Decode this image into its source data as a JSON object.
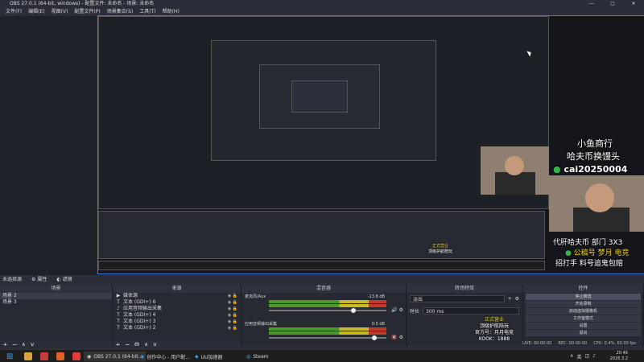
{
  "window": {
    "title": "OBS 27.0.1 (64-bit, windows) - 配置文件: 未命名 - 场景: 未命名",
    "controls": [
      "—",
      "▢",
      "✕"
    ]
  },
  "menu": [
    "文件(F)",
    "编辑(E)",
    "视图(V)",
    "配置文件(P)",
    "场景集合(S)",
    "工具(T)",
    "帮助(H)"
  ],
  "overlay": {
    "shop_line1": "小鱼商行",
    "shop_line2": "哈夫币换馒头",
    "wechat": "cai20250004",
    "stream_line1": "代肝哈夫币 部门 3X3",
    "stream_line2_a": "公稿号",
    "stream_line2_b": "梦月 电竞",
    "stream_line3": "招打手 料号追鬼包赔",
    "badge_line1": "正式营业",
    "badge_line2": "顶级护航陪玩",
    "badge_line3": "官方号：月月电竞",
    "badge_line4": "KOOK：1888"
  },
  "scene_bar": {
    "label": "未选择源",
    "properties": "属性",
    "filters": "滤镜"
  },
  "scenes": {
    "header": "场景",
    "items": [
      "场景 2",
      "场景 3"
    ],
    "selected": 0
  },
  "sources": {
    "header": "来源",
    "items": [
      {
        "label": "媒体源",
        "icon": "▶"
      },
      {
        "label": "文本 (GDI+) 6",
        "icon": "T"
      },
      {
        "label": "应用音频输出采集",
        "icon": "♪"
      },
      {
        "label": "文本 (GDI+) 4",
        "icon": "T"
      },
      {
        "label": "文本 (GDI+) 3",
        "icon": "T"
      },
      {
        "label": "文本 (GDI+) 2",
        "icon": "T"
      }
    ]
  },
  "mixer": {
    "header": "混音器",
    "channels": [
      {
        "name": "麦克风/Aux",
        "db": "-13.8 dB",
        "level": 0.72
      },
      {
        "name": "应用音频输出采集",
        "db": "0.0 dB",
        "level": 0.9
      }
    ]
  },
  "transitions": {
    "header": "转场特效",
    "effect": "淡出",
    "duration_label": "时长",
    "duration_value": "300 ms"
  },
  "controls": {
    "header": "控件",
    "buttons": [
      "停止推流",
      "开始录制",
      "启动虚拟摄像机",
      "工作室模式",
      "设置",
      "退出"
    ],
    "selected": 0
  },
  "status": {
    "live": "LIVE: 00:00:00",
    "rec": "REC: 00:00:00",
    "cpu": "CPU: 0.4%, 60.00 fps"
  },
  "taskbar": {
    "items": [
      "OBS 27.0.1 (64-bit...",
      "创作中心 - 用户配...",
      "UU加速器",
      "Steam"
    ],
    "tray_lang": "英",
    "time": "20:46",
    "date": "2026.3.2"
  },
  "colors": {
    "accent": "#3b7ae8",
    "meter_green": "#4c9a2a",
    "meter_yellow": "#c8b82a",
    "meter_red": "#c23a2a",
    "text_yellow": "#f4d21c"
  }
}
